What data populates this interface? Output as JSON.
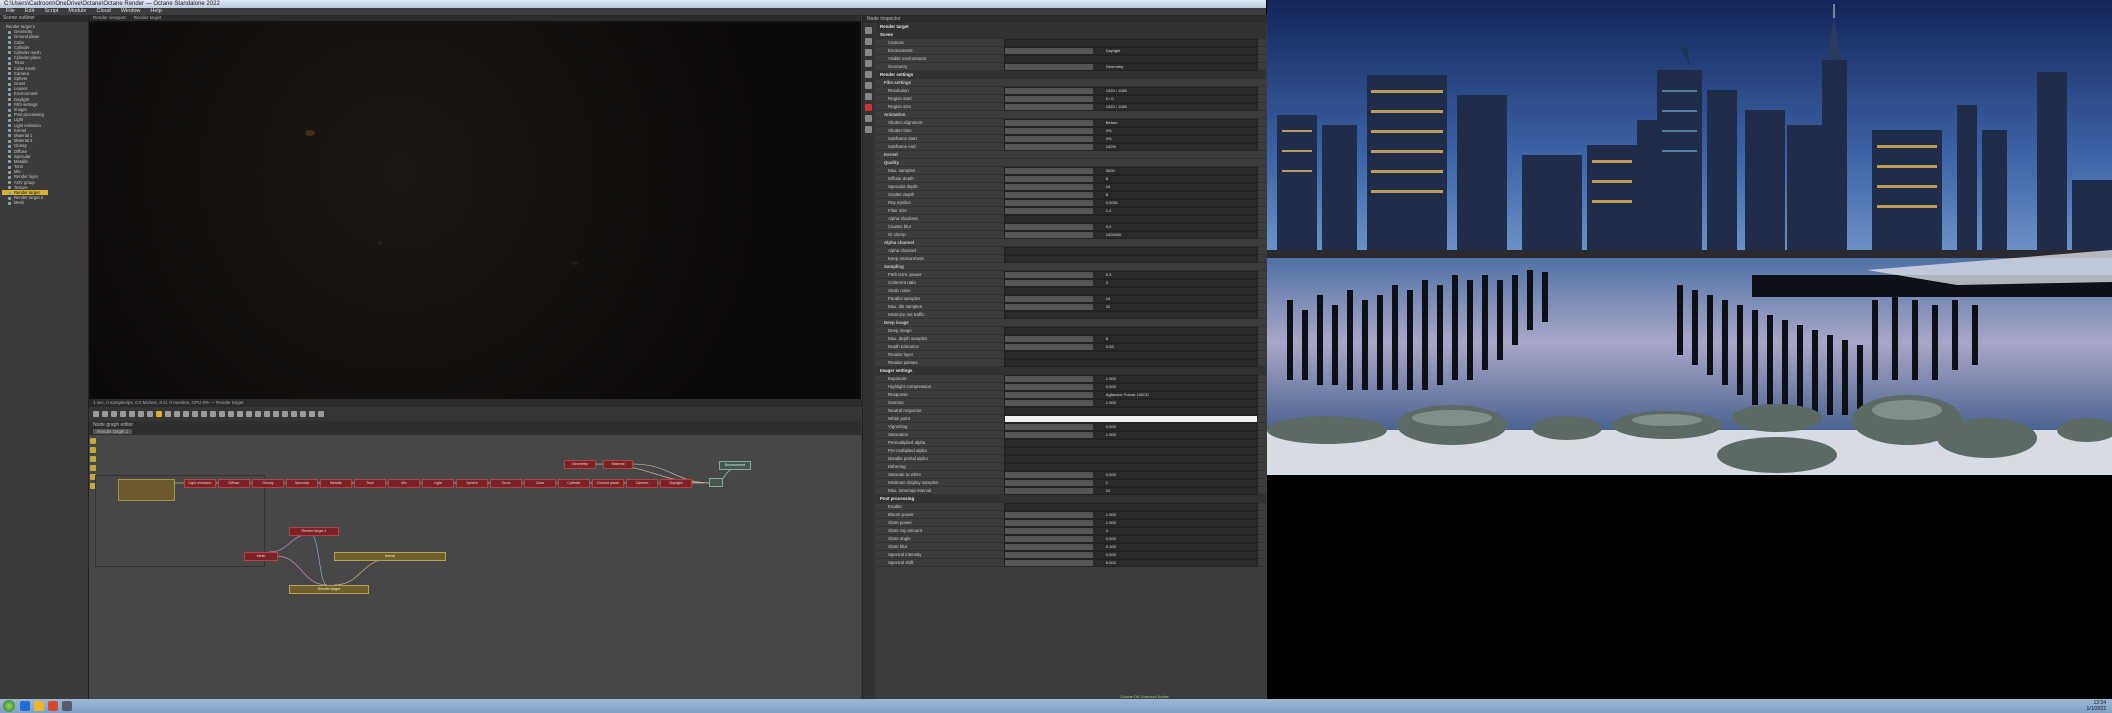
{
  "window": {
    "title": "C:\\Users\\Cadroom\\OneDrive\\Octane\\Octane Render — Octane Standalone 2022"
  },
  "menu": [
    "File",
    "Edit",
    "Script",
    "Module",
    "Cloud",
    "Window",
    "Help"
  ],
  "left_panel": {
    "tab": "Scene outliner",
    "tree": [
      {
        "label": "Render target 1",
        "top": true
      },
      {
        "label": "Geometry",
        "top": false
      },
      {
        "label": "Ground plane",
        "top": false
      },
      {
        "label": "Cube",
        "top": false
      },
      {
        "label": "Cylinder",
        "top": false
      },
      {
        "label": "Cylinder mesh",
        "top": false
      },
      {
        "label": "Cylinder plane",
        "top": false
      },
      {
        "label": "Torus",
        "top": false
      },
      {
        "label": "Cube mesh",
        "top": false
      },
      {
        "label": "Camera",
        "top": false
      },
      {
        "label": "Sphere",
        "top": false
      },
      {
        "label": "Grass",
        "top": false
      },
      {
        "label": "Leaves",
        "top": false
      },
      {
        "label": "Environment",
        "top": false
      },
      {
        "label": "Daylight",
        "top": false
      },
      {
        "label": "Film settings",
        "top": false
      },
      {
        "label": "Imager",
        "top": false
      },
      {
        "label": "Post processing",
        "top": false
      },
      {
        "label": "Light",
        "top": false
      },
      {
        "label": "Light emission",
        "top": false
      },
      {
        "label": "Kernel",
        "top": false
      },
      {
        "label": "Material 1",
        "top": false
      },
      {
        "label": "Material 2",
        "top": false
      },
      {
        "label": "Glossy",
        "top": false
      },
      {
        "label": "Diffuse",
        "top": false
      },
      {
        "label": "Specular",
        "top": false
      },
      {
        "label": "Metallic",
        "top": false
      },
      {
        "label": "Toon",
        "top": false
      },
      {
        "label": "Mix",
        "top": false
      },
      {
        "label": "Render layer",
        "top": false
      },
      {
        "label": "AOV group",
        "top": false
      },
      {
        "label": "Texture",
        "top": false
      },
      {
        "label": "Render target",
        "top": false,
        "selected": true
      },
      {
        "label": "Render target 2",
        "top": false
      },
      {
        "label": "Mesh",
        "top": false
      }
    ]
  },
  "viewport": {
    "tabs": [
      "Render viewport",
      "Render target"
    ],
    "status": "1 sec, 0 samples/px, 0.0 Ms/sec, 0 tri, 0 meshes, GPU 0% — Render target"
  },
  "graph": {
    "tab": "Node graph editor",
    "subtab": "Render target 1",
    "nodes": [
      {
        "label": "Light emission",
        "kind": "red"
      },
      {
        "label": "Diffuse",
        "kind": "red"
      },
      {
        "label": "Glossy",
        "kind": "red"
      },
      {
        "label": "Specular",
        "kind": "red"
      },
      {
        "label": "Metallic",
        "kind": "red"
      },
      {
        "label": "Toon",
        "kind": "red"
      },
      {
        "label": "Mix",
        "kind": "red"
      },
      {
        "label": "Light",
        "kind": "red"
      },
      {
        "label": "Sphere",
        "kind": "red"
      },
      {
        "label": "Torus",
        "kind": "red"
      },
      {
        "label": "Cube",
        "kind": "red"
      },
      {
        "label": "Cylinder",
        "kind": "red"
      },
      {
        "label": "Ground plane",
        "kind": "red"
      },
      {
        "label": "Camera",
        "kind": "red"
      },
      {
        "label": "Daylight",
        "kind": "red"
      },
      {
        "label": "Environment",
        "kind": "green"
      },
      {
        "label": "Geometry",
        "kind": "red"
      },
      {
        "label": "Material",
        "kind": "red"
      },
      {
        "label": "Render target 1",
        "kind": "red"
      },
      {
        "label": "Mesh",
        "kind": "red"
      },
      {
        "label": "Kernel",
        "kind": "yellow"
      },
      {
        "label": "Render target",
        "kind": "yellow"
      }
    ]
  },
  "inspector": {
    "tab": "Node inspector",
    "title": "Render target",
    "rows": [
      {
        "label": "Scene",
        "type": "sec"
      },
      {
        "label": "Camera",
        "value": ""
      },
      {
        "label": "Environment",
        "value": "Daylight"
      },
      {
        "label": "Visible environment",
        "value": ""
      },
      {
        "label": "Geometry",
        "value": "Geometry"
      },
      {
        "label": "Render settings",
        "type": "sec"
      },
      {
        "label": "Film settings",
        "type": "sub"
      },
      {
        "label": "Resolution",
        "value": "1920 / 1080"
      },
      {
        "label": "Region start",
        "value": "0 / 0"
      },
      {
        "label": "Region size",
        "value": "1920 / 1080"
      },
      {
        "label": "Animation",
        "type": "sub"
      },
      {
        "label": "Shutter alignment",
        "value": "Before"
      },
      {
        "label": "Shutter time",
        "value": "0%"
      },
      {
        "label": "Subframe start",
        "value": "0%"
      },
      {
        "label": "Subframe end",
        "value": "100%"
      },
      {
        "label": "Kernel",
        "type": "sub"
      },
      {
        "label": "Quality",
        "type": "sub"
      },
      {
        "label": "Max. samples",
        "value": "5000"
      },
      {
        "label": "Diffuse depth",
        "value": "8"
      },
      {
        "label": "Specular depth",
        "value": "16"
      },
      {
        "label": "Scatter depth",
        "value": "8"
      },
      {
        "label": "Ray epsilon",
        "value": "0.0001"
      },
      {
        "label": "Filter size",
        "value": "1.2"
      },
      {
        "label": "Alpha shadows",
        "value": ""
      },
      {
        "label": "Caustic blur",
        "value": "0.0"
      },
      {
        "label": "GI clamp",
        "value": "1000000"
      },
      {
        "label": "Alpha channel",
        "type": "sub"
      },
      {
        "label": "Alpha channel",
        "value": ""
      },
      {
        "label": "Keep environment",
        "value": ""
      },
      {
        "label": "Sampling",
        "type": "sub"
      },
      {
        "label": "Path term. power",
        "value": "0.3"
      },
      {
        "label": "Coherent ratio",
        "value": "0"
      },
      {
        "label": "Static noise",
        "value": ""
      },
      {
        "label": "Parallel samples",
        "value": "16"
      },
      {
        "label": "Max. tile samples",
        "value": "32"
      },
      {
        "label": "Minimize net traffic",
        "value": ""
      },
      {
        "label": "Deep image",
        "type": "sub"
      },
      {
        "label": "Deep image",
        "value": ""
      },
      {
        "label": "Max. depth samples",
        "value": "8"
      },
      {
        "label": "Depth tolerance",
        "value": "0.05"
      },
      {
        "label": "Render layer",
        "value": ""
      },
      {
        "label": "Render passes",
        "value": ""
      },
      {
        "label": "Imager settings",
        "type": "sec"
      },
      {
        "label": "Exposure",
        "value": "1.000"
      },
      {
        "label": "Highlight compression",
        "value": "0.000"
      },
      {
        "label": "Response",
        "value": "Agfacolor Futura 100CD"
      },
      {
        "label": "Gamma",
        "value": "1.000"
      },
      {
        "label": "Neutral response",
        "value": ""
      },
      {
        "label": "White point",
        "value": "",
        "type": "white"
      },
      {
        "label": "Vignetting",
        "value": "0.000"
      },
      {
        "label": "Saturation",
        "value": "1.000"
      },
      {
        "label": "Premultiplied alpha",
        "value": ""
      },
      {
        "label": "Pre-multiplied alpha",
        "value": ""
      },
      {
        "label": "Disable partial alpha",
        "value": ""
      },
      {
        "label": "Dithering",
        "value": ""
      },
      {
        "label": "Saturate to white",
        "value": "0.000"
      },
      {
        "label": "Minimum display samples",
        "value": "1"
      },
      {
        "label": "Max. tonemap interval",
        "value": "10"
      },
      {
        "label": "Post processing",
        "type": "sec"
      },
      {
        "label": "Enable",
        "value": ""
      },
      {
        "label": "Bloom power",
        "value": "1.000"
      },
      {
        "label": "Glare power",
        "value": "1.000"
      },
      {
        "label": "Glare ray amount",
        "value": "4"
      },
      {
        "label": "Glare angle",
        "value": "0.000"
      },
      {
        "label": "Glare blur",
        "value": "0.100"
      },
      {
        "label": "Spectral intensity",
        "value": "0.000"
      },
      {
        "label": "Spectral shift",
        "value": "6.000"
      }
    ]
  },
  "statusbar": {
    "text": "Octane OK   Licensed   Active"
  },
  "taskbar": {
    "time": "12:34",
    "date": "1/1/2022"
  },
  "colors": {
    "accent": "#d8b12e",
    "node_red": "#7a2225",
    "node_yellow": "#6e5f2a"
  }
}
